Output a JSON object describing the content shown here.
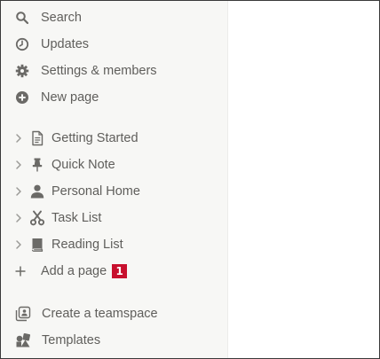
{
  "sidebar": {
    "top_items": [
      {
        "label": "Search",
        "icon": "search-icon"
      },
      {
        "label": "Updates",
        "icon": "clock-icon"
      },
      {
        "label": "Settings & members",
        "icon": "gear-icon"
      },
      {
        "label": "New page",
        "icon": "plus-circle-icon"
      }
    ],
    "pages": [
      {
        "label": "Getting Started",
        "icon": "document-icon"
      },
      {
        "label": "Quick Note",
        "icon": "pushpin-icon"
      },
      {
        "label": "Personal Home",
        "icon": "person-icon"
      },
      {
        "label": "Task List",
        "icon": "scissors-icon"
      },
      {
        "label": "Reading List",
        "icon": "book-icon"
      }
    ],
    "add_page": {
      "label": "Add a page",
      "icon": "plus-icon",
      "badge": "1"
    },
    "bottom_items": [
      {
        "label": "Create a teamspace",
        "icon": "teamspace-icon"
      },
      {
        "label": "Templates",
        "icon": "templates-icon"
      }
    ]
  },
  "colors": {
    "sidebar_bg": "#f7f7f5",
    "text": "#5f5e5b",
    "badge": "#c8102e"
  }
}
